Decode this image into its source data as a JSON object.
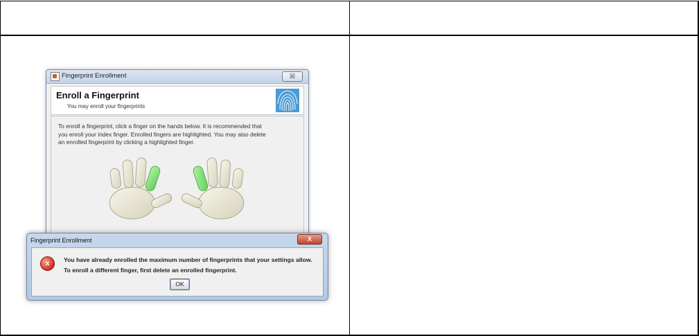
{
  "window": {
    "title": "Fingerprint Enrollment",
    "close_label": "☒",
    "heading": "Enroll a Fingerprint",
    "subheading": "You may enroll your fingerprints",
    "instructions": [
      "To enroll a fingerprint, click a finger on the hands below. It is recommended that",
      "you enroll your index finger. Enrolled fingers are highlighted. You may also delete",
      "an enrolled fingerprint by clicking a highlighted finger."
    ],
    "enrolled_fingers": [
      "left-index",
      "right-index"
    ],
    "colors": {
      "enrolled": "#7fe07f",
      "finger": "#ece8d6"
    }
  },
  "dialog": {
    "title": "Fingerprint Enrollment",
    "close_label": "X",
    "error_icon_label": "x",
    "message_line1": "You have already enrolled the maximum number of fingerprints that your settings allow.",
    "message_line2": "To enroll a different finger, first delete an enrolled fingerprint.",
    "ok_label": "OK"
  }
}
